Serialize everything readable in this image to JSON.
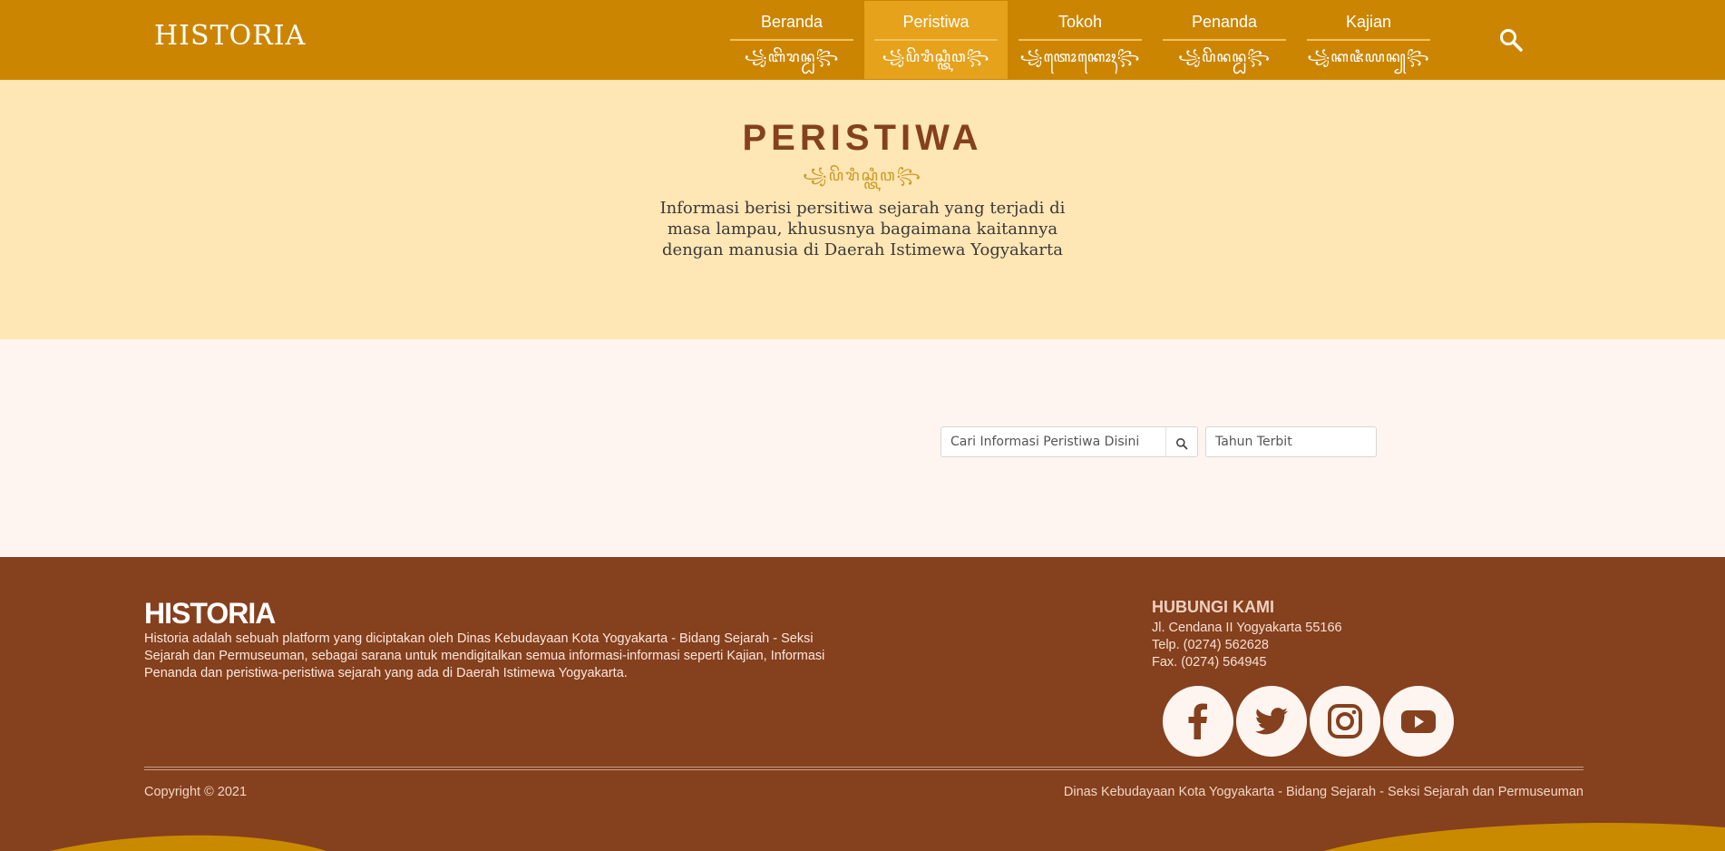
{
  "header": {
    "brand": "HISTORIA",
    "nav": [
      {
        "label": "Beranda",
        "javanese": "꧁ꦧꦼꦫꦤ꧀ꦝ꧂"
      },
      {
        "label": "Peristiwa",
        "javanese": "꧁ꦥꦼꦫꦶꦱ꧀ꦠꦶꦮ꧂"
      },
      {
        "label": "Tokoh",
        "javanese": "꧁ꦠꦺꦴꦏꦺꦴꦃ꧂"
      },
      {
        "label": "Penanda",
        "javanese": "꧁ꦥꦼꦤꦤ꧀ꦝ꧂"
      },
      {
        "label": "Kajian",
        "javanese": "꧁ꦏꦗꦶꦪꦤ꧀꧂"
      }
    ],
    "active_index": 1,
    "search_icon": "search-icon"
  },
  "hero": {
    "title": "PERISTIWA",
    "javanese": "꧁ꦥꦼꦫꦶꦱ꧀ꦠꦶꦮ꧂",
    "description": "Informasi berisi persitiwa sejarah yang terjadi di masa lampau, khususnya bagaimana kaitannya dengan manusia di Daerah Istimewa Yogyakarta"
  },
  "filters": {
    "search_placeholder": "Cari Informasi Peristiwa Disini",
    "year_placeholder": "Tahun Terbit"
  },
  "footer": {
    "brand": "HISTORIA",
    "description": "Historia adalah sebuah platform yang diciptakan oleh Dinas Kebudayaan Kota Yogyakarta - Bidang Sejarah - Seksi Sejarah dan Permuseuman, sebagai sarana untuk mendigitalkan semua informasi-informasi seperti Kajian, Informasi Penanda dan peristiwa-peristiwa sejarah yang ada di Daerah Istimewa Yogyakarta.",
    "contact_title": "HUBUNGI KAMI",
    "address": "Jl. Cendana II Yogyakarta 55166",
    "phone": "Telp. (0274) 562628",
    "fax": "Fax. (0274) 564945",
    "social": [
      "facebook-icon",
      "twitter-icon",
      "instagram-icon",
      "youtube-icon"
    ],
    "copyright": "Copyright © 2021",
    "credit": "Dinas Kebudayaan Kota Yogyakarta - Bidang Sejarah - Seksi Sejarah dan Permuseuman"
  },
  "colors": {
    "header": "#cc8500",
    "nav_active": "#e6a21b",
    "hero_bg": "#ffe6b5",
    "title": "#85411c",
    "page_bg": "#fff5f0",
    "footer": "#85401e"
  }
}
